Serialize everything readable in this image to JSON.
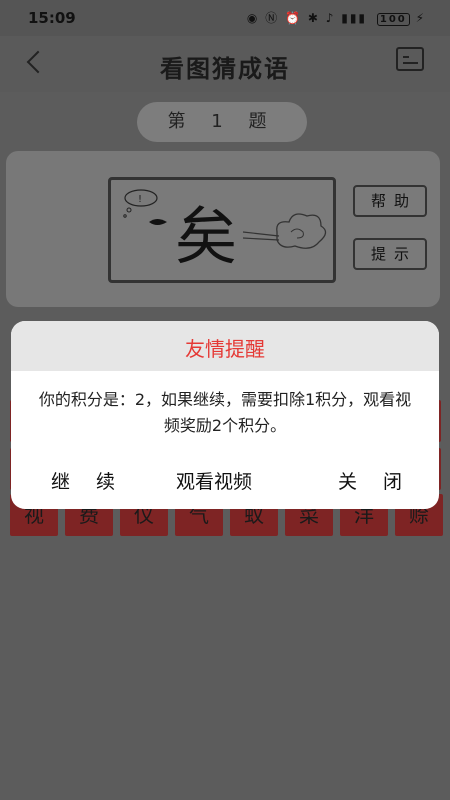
{
  "status": {
    "time": "15:09",
    "battery": "100"
  },
  "header": {
    "title": "看图猜成语"
  },
  "question": {
    "badge": "第 1 题"
  },
  "puzzle": {
    "character": "矣"
  },
  "buttons": {
    "help": "帮助",
    "hint": "提示"
  },
  "tiles": [
    "视",
    "费",
    "仪",
    "气",
    "蚁",
    "菜",
    "洋",
    "赊"
  ],
  "dialog": {
    "title": "友情提醒",
    "message": "你的积分是：2，如果继续，需要扣除1积分，观看视频奖励2个积分。",
    "continue": "继 续",
    "watch_video": "观看视频",
    "close": "关 闭"
  },
  "colors": {
    "dialog_title": "#e53935",
    "tile": "#7e2424"
  }
}
